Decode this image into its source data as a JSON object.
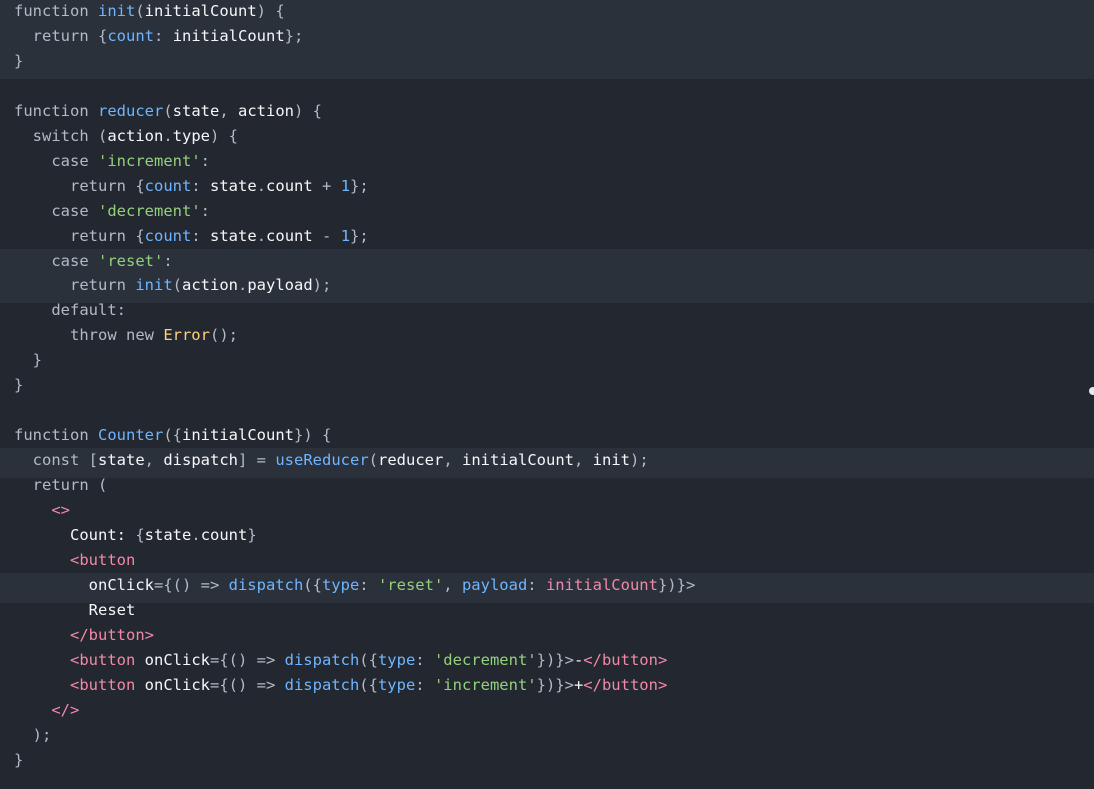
{
  "editor": {
    "language": "javascript",
    "highlighted_lines": [
      0,
      1,
      2,
      10,
      11,
      18,
      23
    ],
    "lines": [
      [
        [
          "kw",
          "function "
        ],
        [
          "fn",
          "init"
        ],
        [
          "pr",
          "("
        ],
        [
          "tx",
          "initialCount"
        ],
        [
          "pr",
          ") {"
        ]
      ],
      [
        [
          "kw",
          "  return "
        ],
        [
          "pr",
          "{"
        ],
        [
          "at",
          "count"
        ],
        [
          "pr",
          ": "
        ],
        [
          "tx",
          "initialCount"
        ],
        [
          "pr",
          "};"
        ]
      ],
      [
        [
          "pr",
          "}"
        ]
      ],
      [],
      [
        [
          "kw",
          "function "
        ],
        [
          "fn",
          "reducer"
        ],
        [
          "pr",
          "("
        ],
        [
          "tx",
          "state"
        ],
        [
          "pr",
          ", "
        ],
        [
          "tx",
          "action"
        ],
        [
          "pr",
          ") {"
        ]
      ],
      [
        [
          "kw",
          "  switch "
        ],
        [
          "pr",
          "("
        ],
        [
          "tx",
          "action"
        ],
        [
          "pr",
          "."
        ],
        [
          "tx",
          "type"
        ],
        [
          "pr",
          ") {"
        ]
      ],
      [
        [
          "kw",
          "    case "
        ],
        [
          "st",
          "'increment'"
        ],
        [
          "pr",
          ":"
        ]
      ],
      [
        [
          "kw",
          "      return "
        ],
        [
          "pr",
          "{"
        ],
        [
          "at",
          "count"
        ],
        [
          "pr",
          ": "
        ],
        [
          "tx",
          "state"
        ],
        [
          "pr",
          "."
        ],
        [
          "tx",
          "count "
        ],
        [
          "pr",
          "+ "
        ],
        [
          "nm",
          "1"
        ],
        [
          "pr",
          "};"
        ]
      ],
      [
        [
          "kw",
          "    case "
        ],
        [
          "st",
          "'decrement'"
        ],
        [
          "pr",
          ":"
        ]
      ],
      [
        [
          "kw",
          "      return "
        ],
        [
          "pr",
          "{"
        ],
        [
          "at",
          "count"
        ],
        [
          "pr",
          ": "
        ],
        [
          "tx",
          "state"
        ],
        [
          "pr",
          "."
        ],
        [
          "tx",
          "count "
        ],
        [
          "pr",
          "- "
        ],
        [
          "nm",
          "1"
        ],
        [
          "pr",
          "};"
        ]
      ],
      [
        [
          "kw",
          "    case "
        ],
        [
          "st",
          "'reset'"
        ],
        [
          "pr",
          ":"
        ]
      ],
      [
        [
          "kw",
          "      return "
        ],
        [
          "fn",
          "init"
        ],
        [
          "pr",
          "("
        ],
        [
          "tx",
          "action"
        ],
        [
          "pr",
          "."
        ],
        [
          "tx",
          "payload"
        ],
        [
          "pr",
          ");"
        ]
      ],
      [
        [
          "kw",
          "    default"
        ],
        [
          "pr",
          ":"
        ]
      ],
      [
        [
          "kw",
          "      throw new "
        ],
        [
          "cl",
          "Error"
        ],
        [
          "pr",
          "();"
        ]
      ],
      [
        [
          "pr",
          "  }"
        ]
      ],
      [
        [
          "pr",
          "}"
        ]
      ],
      [],
      [
        [
          "kw",
          "function "
        ],
        [
          "fn",
          "Counter"
        ],
        [
          "pr",
          "({"
        ],
        [
          "tx",
          "initialCount"
        ],
        [
          "pr",
          "}) {"
        ]
      ],
      [
        [
          "kw",
          "  const "
        ],
        [
          "pr",
          "["
        ],
        [
          "tx",
          "state"
        ],
        [
          "pr",
          ", "
        ],
        [
          "tx",
          "dispatch"
        ],
        [
          "pr",
          "] = "
        ],
        [
          "fn",
          "useReducer"
        ],
        [
          "pr",
          "("
        ],
        [
          "tx",
          "reducer"
        ],
        [
          "pr",
          ", "
        ],
        [
          "tx",
          "initialCount"
        ],
        [
          "pr",
          ", "
        ],
        [
          "tx",
          "init"
        ],
        [
          "pr",
          ");"
        ]
      ],
      [
        [
          "kw",
          "  return "
        ],
        [
          "pr",
          "("
        ]
      ],
      [
        [
          "tg",
          "    <>"
        ]
      ],
      [
        [
          "tx",
          "      Count: "
        ],
        [
          "pr",
          "{"
        ],
        [
          "tx",
          "state"
        ],
        [
          "pr",
          "."
        ],
        [
          "tx",
          "count"
        ],
        [
          "pr",
          "}"
        ]
      ],
      [
        [
          "tg",
          "      <button"
        ]
      ],
      [
        [
          "tx",
          "        onClick"
        ],
        [
          "pr",
          "={() => "
        ],
        [
          "fn",
          "dispatch"
        ],
        [
          "pr",
          "({"
        ],
        [
          "at",
          "type"
        ],
        [
          "pr",
          ": "
        ],
        [
          "st",
          "'reset'"
        ],
        [
          "pr",
          ", "
        ],
        [
          "at",
          "payload"
        ],
        [
          "pr",
          ": "
        ],
        [
          "tg",
          "initialCount"
        ],
        [
          "pr",
          "})}>"
        ]
      ],
      [
        [
          "tx",
          "        Reset"
        ]
      ],
      [
        [
          "tg",
          "      </button>"
        ]
      ],
      [
        [
          "tg",
          "      <button "
        ],
        [
          "tx",
          "onClick"
        ],
        [
          "pr",
          "={() => "
        ],
        [
          "fn",
          "dispatch"
        ],
        [
          "pr",
          "({"
        ],
        [
          "at",
          "type"
        ],
        [
          "pr",
          ": "
        ],
        [
          "st",
          "'decrement'"
        ],
        [
          "pr",
          "})}>"
        ],
        [
          "tx",
          "-"
        ],
        [
          "tg",
          "</button>"
        ]
      ],
      [
        [
          "tg",
          "      <button "
        ],
        [
          "tx",
          "onClick"
        ],
        [
          "pr",
          "={() => "
        ],
        [
          "fn",
          "dispatch"
        ],
        [
          "pr",
          "({"
        ],
        [
          "at",
          "type"
        ],
        [
          "pr",
          ": "
        ],
        [
          "st",
          "'increment'"
        ],
        [
          "pr",
          "})}>"
        ],
        [
          "tx",
          "+"
        ],
        [
          "tg",
          "</button>"
        ]
      ],
      [
        [
          "tg",
          "    </>"
        ]
      ],
      [
        [
          "pr",
          "  );"
        ]
      ],
      [
        [
          "pr",
          "}"
        ]
      ]
    ]
  },
  "colors": {
    "background": "#23272f",
    "highlight": "#2b313b",
    "keyword": "#b3bac6",
    "function": "#6fb5ff",
    "string": "#93d17d",
    "tag": "#f289a8",
    "class": "#ffd27a"
  }
}
